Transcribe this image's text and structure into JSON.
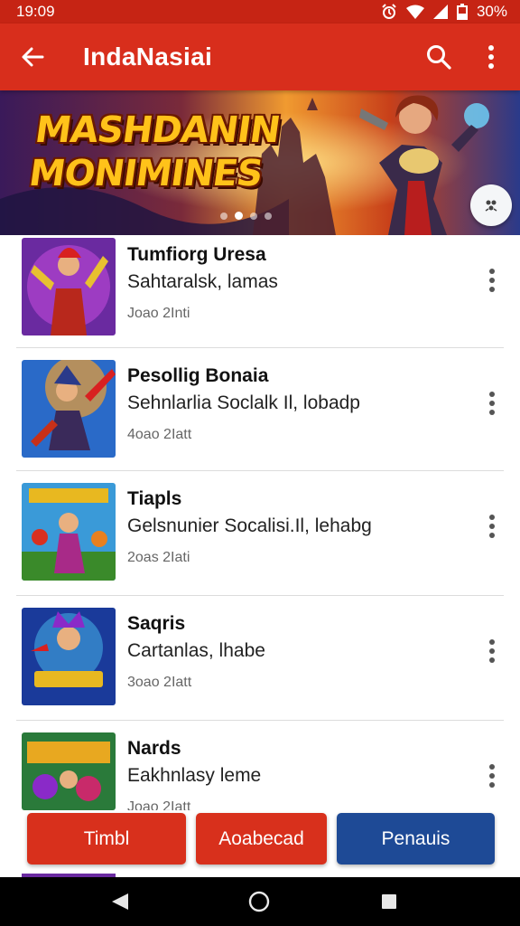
{
  "status_bar": {
    "time": "19:09",
    "battery": "30%"
  },
  "app_bar": {
    "title": "IndaNasiai",
    "back_icon": "arrow-left-icon",
    "search_icon": "search-icon",
    "more_icon": "more-vertical-icon"
  },
  "banner": {
    "title_line1": "MASHDANIN",
    "title_line2": "MONIMINES",
    "page_indicator": {
      "count": 4,
      "active_index": 1
    }
  },
  "list": {
    "items": [
      {
        "title": "Tumfiorg Uresa",
        "subtitle": "Sahtaralsk, lamas",
        "meta": "Joao 2Inti"
      },
      {
        "title": "Pesollig Bonaia",
        "subtitle": "Sehnlarlia Soclalk Il, lobadp",
        "meta": "4oao 2Iatt"
      },
      {
        "title": "Tiapls",
        "subtitle": "Gelsnunier Socalisi.Il, lehabg",
        "meta": "2oas 2Iati"
      },
      {
        "title": "Saqris",
        "subtitle": "Cartanlas, lhabe",
        "meta": "3oao 2Iatt"
      },
      {
        "title": "Nards",
        "subtitle": "Eakhnlasy leme",
        "meta": "Joao 2Iatt"
      }
    ]
  },
  "buttons": {
    "primary": "Timbl",
    "secondary": "Aoabecad",
    "tertiary": "Penauis"
  },
  "colors": {
    "app_bar": "#d82e1c",
    "status_bar": "#c62414",
    "primary_button": "#d8301c",
    "tertiary_button": "#1e4a96"
  }
}
